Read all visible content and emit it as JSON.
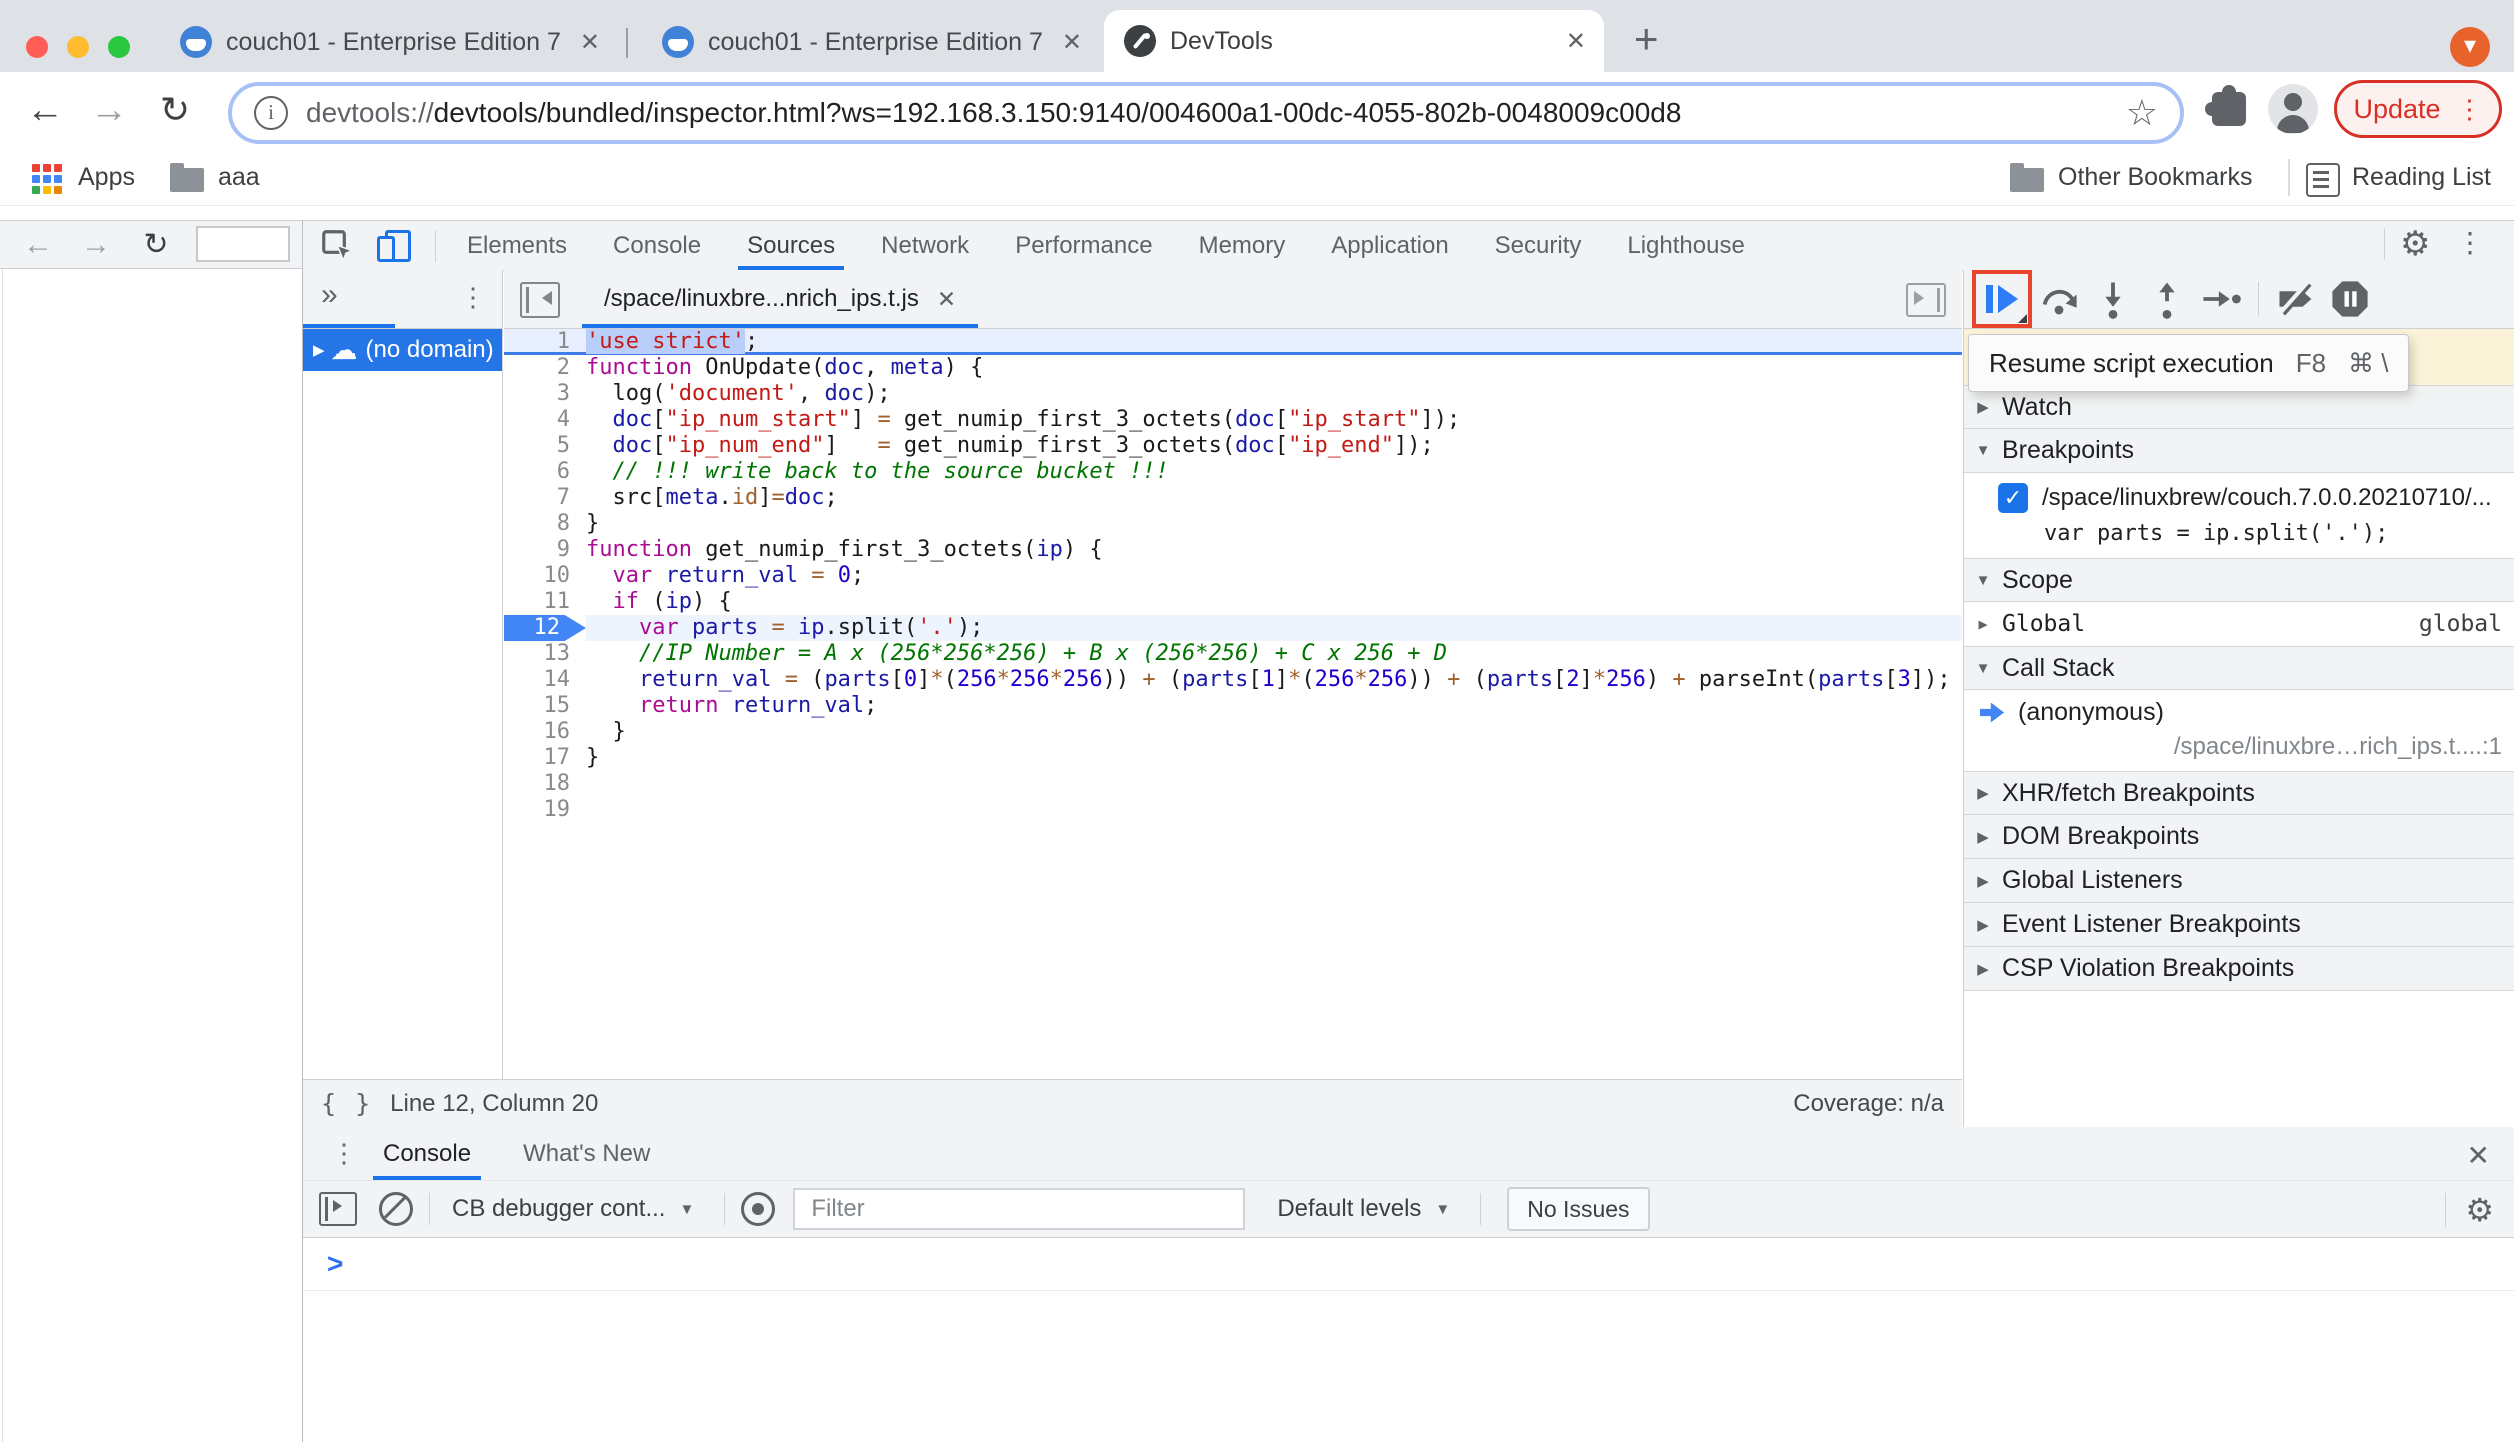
{
  "browser": {
    "tabs": [
      {
        "title": "couch01 - Enterprise Edition 7."
      },
      {
        "title": "couch01 - Enterprise Edition 7."
      },
      {
        "title": "DevTools"
      }
    ],
    "url_scheme": "devtools://",
    "url_rest": "devtools/bundled/inspector.html?ws=192.168.3.150:9140/004600a1-00dc-4055-802b-0048009c00d8",
    "update_label": "Update",
    "bookmarks_bar": {
      "apps": "Apps",
      "folder": "aaa",
      "other_bookmarks": "Other Bookmarks",
      "reading_list": "Reading List"
    }
  },
  "devtools": {
    "tabs": [
      "Elements",
      "Console",
      "Sources",
      "Network",
      "Performance",
      "Memory",
      "Application",
      "Security",
      "Lighthouse"
    ],
    "active_tab": "Sources",
    "navigator_domain": "(no domain)",
    "file_tab": "/space/linuxbre...nrich_ips.t.js",
    "code": {
      "lines": [
        {
          "n": 1,
          "f": "hl",
          "t": [
            [
              "ss",
              "'use strict'"
            ],
            [
              "p",
              ";"
            ]
          ]
        },
        {
          "n": 2,
          "t": [
            [
              "k",
              "function"
            ],
            [
              "p",
              " OnUpdate("
            ],
            [
              "v",
              "doc"
            ],
            [
              "p",
              ", "
            ],
            [
              "v",
              "meta"
            ],
            [
              "p",
              ") {"
            ]
          ]
        },
        {
          "n": 3,
          "t": [
            [
              "p",
              "  log("
            ],
            [
              "s",
              "'document'"
            ],
            [
              "p",
              ", "
            ],
            [
              "v",
              "doc"
            ],
            [
              "p",
              ");"
            ]
          ]
        },
        {
          "n": 4,
          "t": [
            [
              "p",
              "  "
            ],
            [
              "v",
              "doc"
            ],
            [
              "p",
              "["
            ],
            [
              "s",
              "\"ip_num_start\""
            ],
            [
              "p",
              "] "
            ],
            [
              "o",
              "="
            ],
            [
              "p",
              " get_numip_first_3_octets("
            ],
            [
              "v",
              "doc"
            ],
            [
              "p",
              "["
            ],
            [
              "s",
              "\"ip_start\""
            ],
            [
              "p",
              "]);"
            ]
          ]
        },
        {
          "n": 5,
          "t": [
            [
              "p",
              "  "
            ],
            [
              "v",
              "doc"
            ],
            [
              "p",
              "["
            ],
            [
              "s",
              "\"ip_num_end\""
            ],
            [
              "p",
              "]   "
            ],
            [
              "o",
              "="
            ],
            [
              "p",
              " get_numip_first_3_octets("
            ],
            [
              "v",
              "doc"
            ],
            [
              "p",
              "["
            ],
            [
              "s",
              "\"ip_end\""
            ],
            [
              "p",
              "]);"
            ]
          ]
        },
        {
          "n": 6,
          "t": [
            [
              "c",
              "  // !!! write back to the source bucket !!!"
            ]
          ]
        },
        {
          "n": 7,
          "t": [
            [
              "p",
              "  src["
            ],
            [
              "v",
              "meta"
            ],
            [
              "p",
              "."
            ],
            [
              "o",
              "id"
            ],
            [
              "p",
              "]"
            ],
            [
              "o",
              "="
            ],
            [
              "v",
              "doc"
            ],
            [
              "p",
              ";"
            ]
          ]
        },
        {
          "n": 8,
          "t": [
            [
              "p",
              "}"
            ]
          ]
        },
        {
          "n": 9,
          "t": [
            [
              "k",
              "function"
            ],
            [
              "p",
              " get_numip_first_3_octets("
            ],
            [
              "v",
              "ip"
            ],
            [
              "p",
              ") {"
            ]
          ]
        },
        {
          "n": 10,
          "t": [
            [
              "p",
              "  "
            ],
            [
              "k",
              "var"
            ],
            [
              "p",
              " "
            ],
            [
              "v",
              "return_val"
            ],
            [
              "p",
              " "
            ],
            [
              "o",
              "="
            ],
            [
              "p",
              " "
            ],
            [
              "n2",
              "0"
            ],
            [
              "p",
              ";"
            ]
          ]
        },
        {
          "n": 11,
          "t": [
            [
              "p",
              "  "
            ],
            [
              "k",
              "if"
            ],
            [
              "p",
              " ("
            ],
            [
              "v",
              "ip"
            ],
            [
              "p",
              ") {"
            ]
          ]
        },
        {
          "n": 12,
          "f": "exec",
          "t": [
            [
              "p",
              "    "
            ],
            [
              "k",
              "var"
            ],
            [
              "p",
              " "
            ],
            [
              "v",
              "parts"
            ],
            [
              "p",
              " "
            ],
            [
              "o",
              "="
            ],
            [
              "p",
              " "
            ],
            [
              "v",
              "ip"
            ],
            [
              "p",
              ".split("
            ],
            [
              "s",
              "'.'"
            ],
            [
              "p",
              ");"
            ]
          ]
        },
        {
          "n": 13,
          "t": [
            [
              "c",
              "    //IP Number = A x (256*256*256) + B x (256*256) + C x 256 + D"
            ]
          ]
        },
        {
          "n": 14,
          "t": [
            [
              "p",
              "    "
            ],
            [
              "v",
              "return_val"
            ],
            [
              "p",
              " "
            ],
            [
              "o",
              "="
            ],
            [
              "p",
              " ("
            ],
            [
              "v",
              "parts"
            ],
            [
              "p",
              "["
            ],
            [
              "n2",
              "0"
            ],
            [
              "p",
              "]"
            ],
            [
              "o",
              "*"
            ],
            [
              "p",
              "("
            ],
            [
              "n2",
              "256"
            ],
            [
              "o",
              "*"
            ],
            [
              "n2",
              "256"
            ],
            [
              "o",
              "*"
            ],
            [
              "n2",
              "256"
            ],
            [
              "p",
              ")) "
            ],
            [
              "o",
              "+"
            ],
            [
              "p",
              " ("
            ],
            [
              "v",
              "parts"
            ],
            [
              "p",
              "["
            ],
            [
              "n2",
              "1"
            ],
            [
              "p",
              "]"
            ],
            [
              "o",
              "*"
            ],
            [
              "p",
              "("
            ],
            [
              "n2",
              "256"
            ],
            [
              "o",
              "*"
            ],
            [
              "n2",
              "256"
            ],
            [
              "p",
              ")) "
            ],
            [
              "o",
              "+"
            ],
            [
              "p",
              " ("
            ],
            [
              "v",
              "parts"
            ],
            [
              "p",
              "["
            ],
            [
              "n2",
              "2"
            ],
            [
              "p",
              "]"
            ],
            [
              "o",
              "*"
            ],
            [
              "n2",
              "256"
            ],
            [
              "p",
              ") "
            ],
            [
              "o",
              "+"
            ],
            [
              "p",
              " parseInt("
            ],
            [
              "v",
              "parts"
            ],
            [
              "p",
              "["
            ],
            [
              "n2",
              "3"
            ],
            [
              "p",
              "]);"
            ]
          ]
        },
        {
          "n": 15,
          "t": [
            [
              "p",
              "    "
            ],
            [
              "k",
              "return"
            ],
            [
              "p",
              " "
            ],
            [
              "v",
              "return_val"
            ],
            [
              "p",
              ";"
            ]
          ]
        },
        {
          "n": 16,
          "t": [
            [
              "p",
              "  }"
            ]
          ]
        },
        {
          "n": 17,
          "t": [
            [
              "p",
              "}"
            ]
          ]
        },
        {
          "n": 18,
          "t": []
        },
        {
          "n": 19,
          "t": []
        }
      ]
    },
    "status_bar": {
      "position": "Line 12, Column 20",
      "coverage": "Coverage: n/a"
    },
    "debugger_sidebar": {
      "tooltip": {
        "label": "Resume script execution",
        "key1": "F8",
        "key2": "⌘ \\"
      },
      "watch": "Watch",
      "breakpoints": "Breakpoints",
      "breakpoint_file": "/space/linuxbrew/couch.7.0.0.20210710/...",
      "breakpoint_code": "var parts = ip.split('.');",
      "scope": "Scope",
      "scope_name": "Global",
      "scope_type": "global",
      "call_stack": "Call Stack",
      "frame_name": "(anonymous)",
      "frame_location": "/space/linuxbre…rich_ips.t....:1",
      "collapsed_sections": [
        "XHR/fetch Breakpoints",
        "DOM Breakpoints",
        "Global Listeners",
        "Event Listener Breakpoints",
        "CSP Violation Breakpoints"
      ]
    },
    "console_drawer": {
      "tab_console": "Console",
      "tab_whats_new": "What's New",
      "context": "CB debugger cont...",
      "filter_placeholder": "Filter",
      "levels": "Default levels",
      "no_issues": "No Issues"
    }
  },
  "icons": {
    "close": "✕",
    "plus": "+",
    "back": "←",
    "forward": "→",
    "reload": "↻",
    "star": "☆",
    "kebab": "⋮",
    "double_chevron": "»",
    "gear": "⚙",
    "cloud": "☁",
    "tri_right": "▶",
    "tri_down": "▼",
    "check": "✓",
    "braces": "{ }",
    "prompt": ">",
    "caret_down": "▼",
    "menu_down": "▾",
    "info": "i"
  }
}
